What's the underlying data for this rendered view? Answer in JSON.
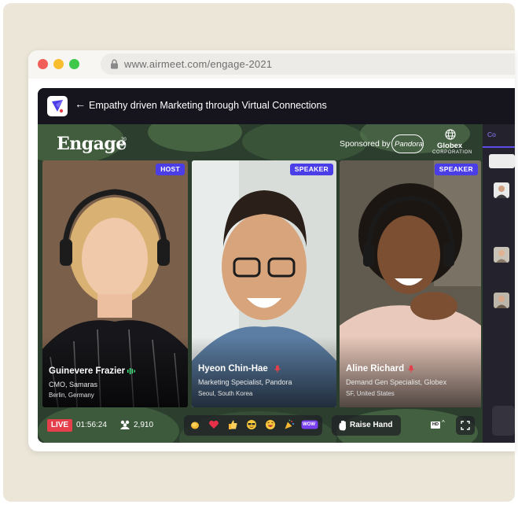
{
  "browser": {
    "url": "www.airmeet.com/engage-2021"
  },
  "session": {
    "title": "Empathy driven Marketing through Virtual Connections"
  },
  "event": {
    "brand": "Engage",
    "year_top": "20",
    "year_bottom": "21",
    "sponsored_label": "Sponsored by",
    "sponsor_1": "Pandora",
    "sponsor_2": "Globex",
    "sponsor_2_sub": "CORPORATION"
  },
  "participants": [
    {
      "badge": "HOST",
      "name": "Guinevere Frazier",
      "role": "CMO, Samaras",
      "location": "Berlin, Germany",
      "mic": "on"
    },
    {
      "badge": "SPEAKER",
      "name": "Hyeon Chin-Hae",
      "role": "Marketing Specialist, Pandora",
      "location": "Seoul, South Korea",
      "mic": "muted"
    },
    {
      "badge": "SPEAKER",
      "name": "Aline Richard",
      "role": "Demand Gen Specialist, Globex",
      "location": "SF, United States",
      "mic": "muted"
    }
  ],
  "controls": {
    "live_label": "LIVE",
    "live_time": "01:56:24",
    "attendee_count": "2,910",
    "raise_hand_label": "Raise Hand",
    "quality": "HD",
    "reactions": [
      "clap",
      "heart",
      "thumbs-up",
      "cool",
      "laugh",
      "party",
      "wow"
    ],
    "wow_label": "WOW"
  },
  "side_panel": {
    "tab_label": "Co"
  },
  "colors": {
    "accent": "#4c3ee6",
    "live": "#e43f4a",
    "app_bg": "#1c1b25"
  }
}
